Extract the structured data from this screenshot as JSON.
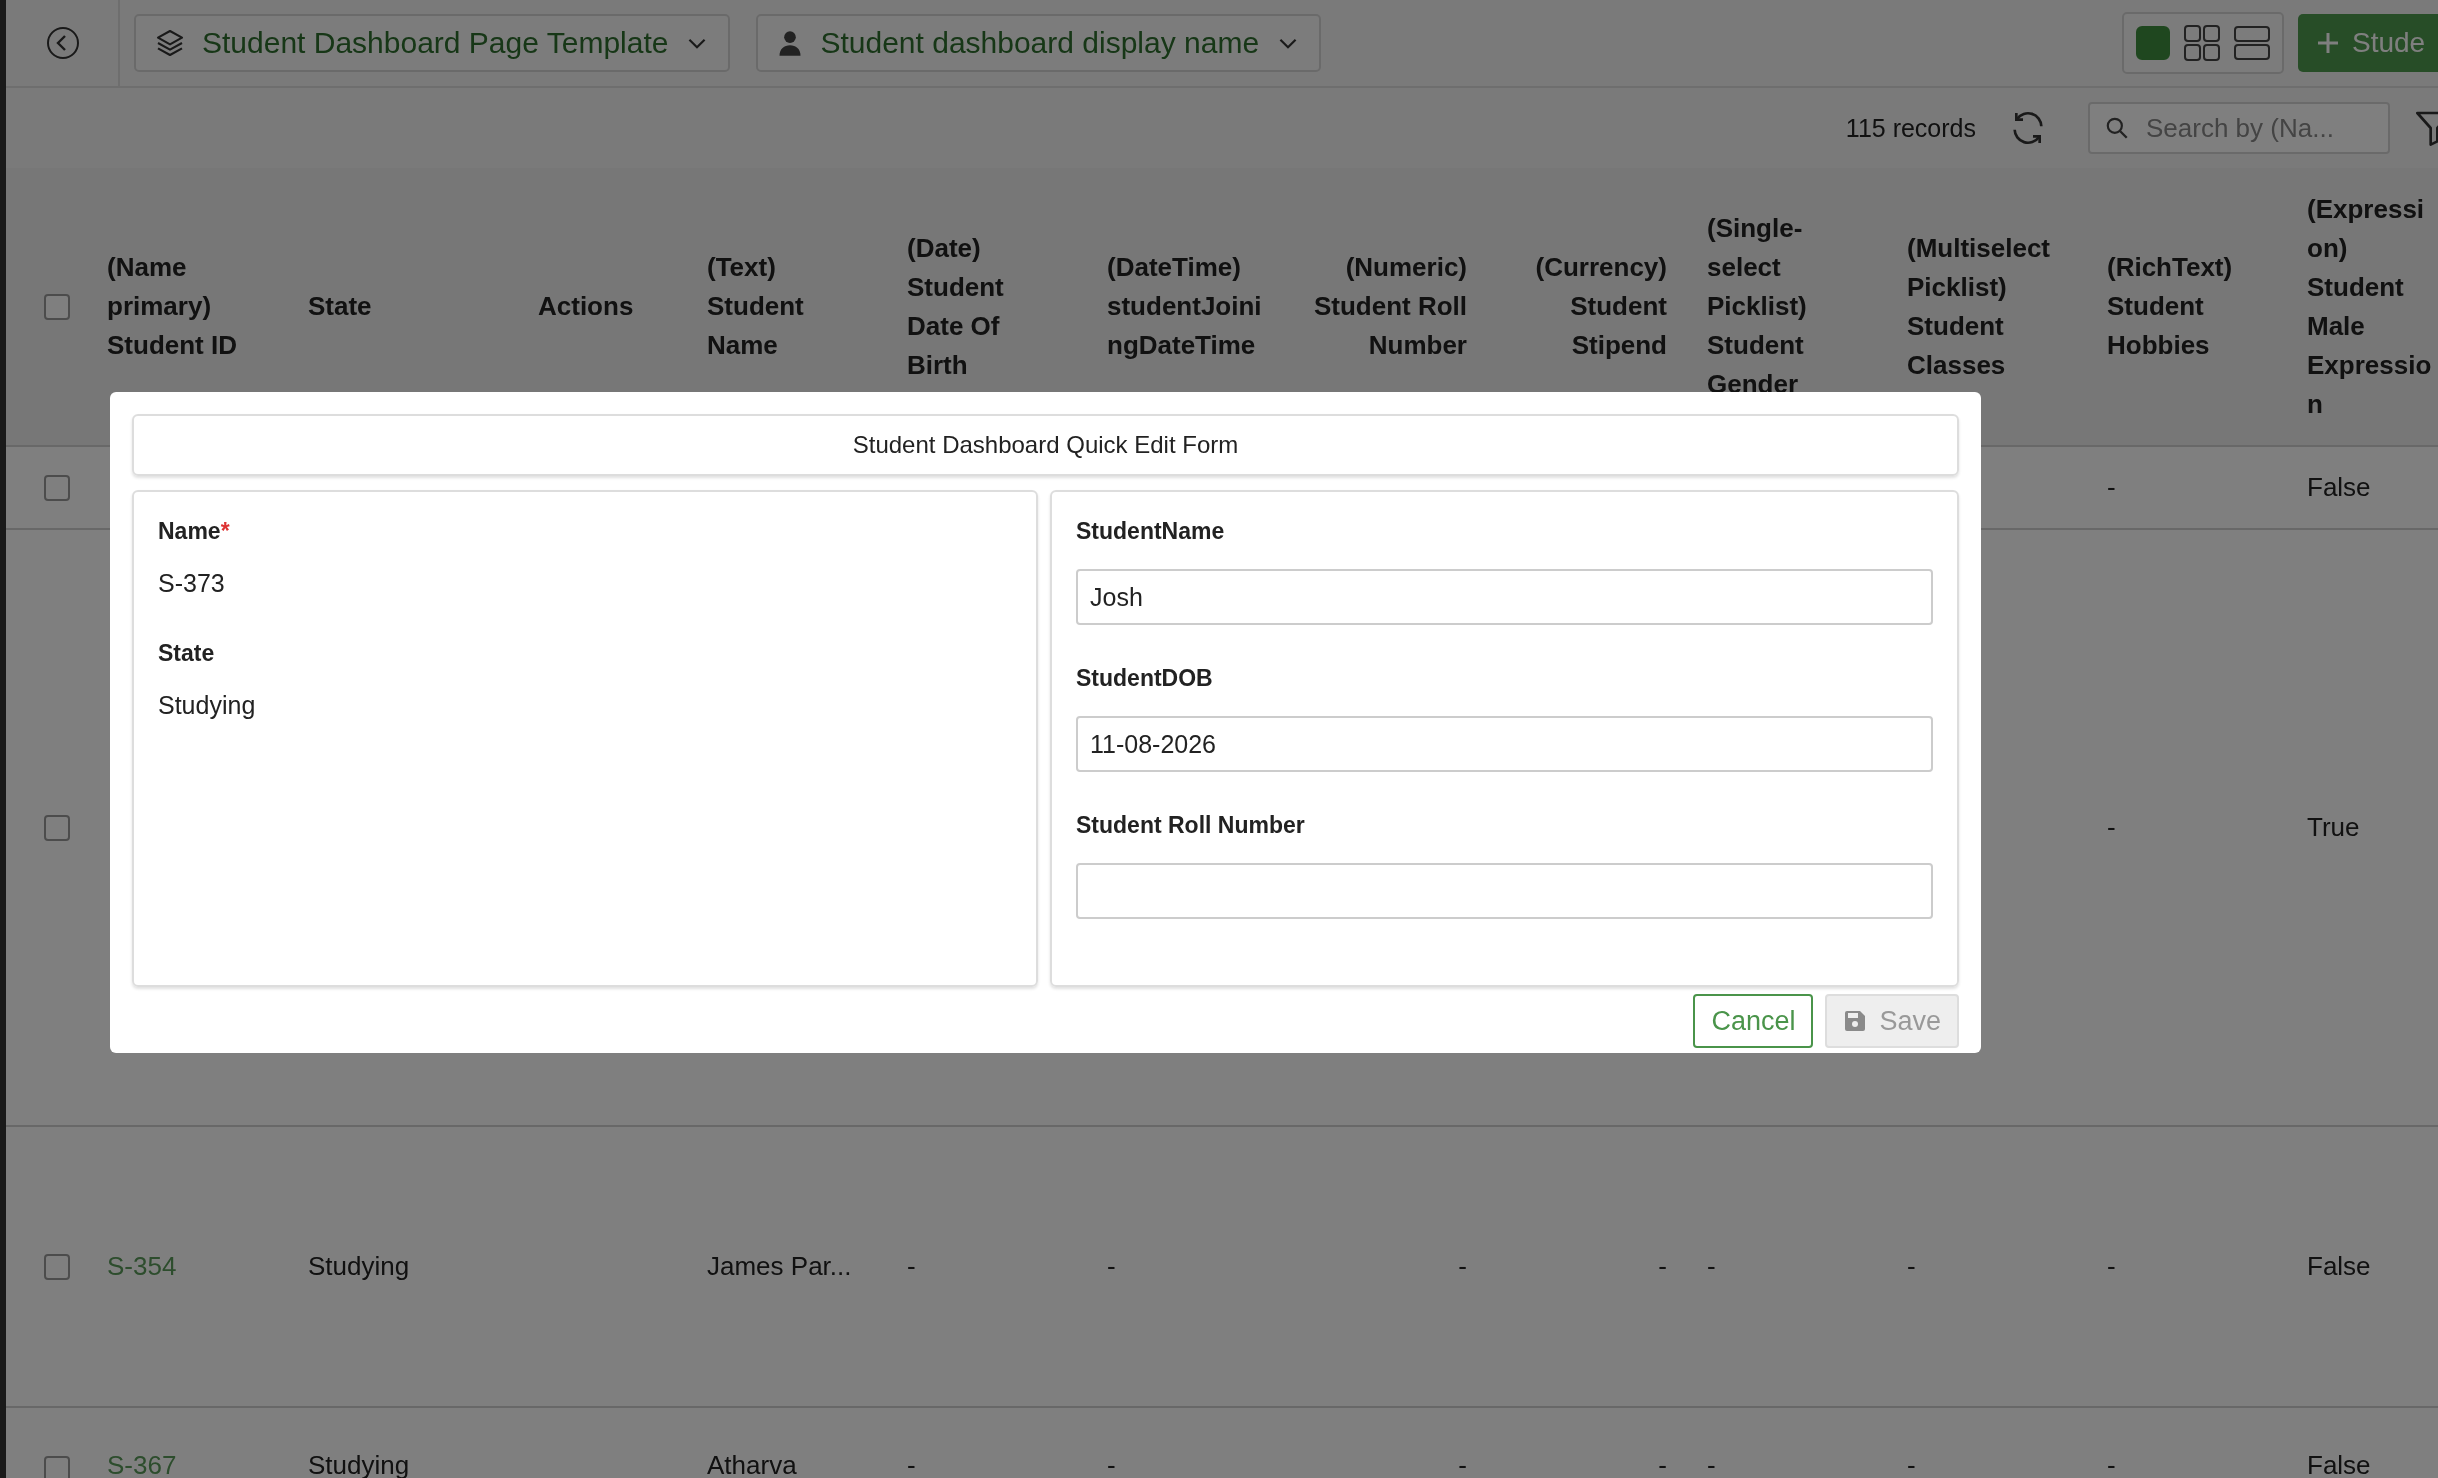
{
  "top_bar": {
    "template_dropdown": {
      "label": "Student Dashboard Page Template"
    },
    "display_name_dropdown": {
      "label": "Student dashboard display name"
    },
    "view_modes": [
      {
        "kind": "single",
        "selected": true
      },
      {
        "kind": "grid",
        "selected": false
      },
      {
        "kind": "list",
        "selected": false
      }
    ],
    "add_button": {
      "label": "Stude"
    }
  },
  "toolbar": {
    "record_count": "115 records",
    "search": {
      "placeholder": "Search by (Na..."
    }
  },
  "table": {
    "select_all_checked": false,
    "columns": [
      "(Name primary) Student ID",
      "State",
      "Actions",
      "(Text) Student Name",
      "(Date) Student Date Of Birth",
      "(DateTime) studentJoiningDateTime",
      "(Numeric) Student Roll Number",
      "(Currency) Student Stipend",
      "(Single-select Picklist) Student Gender",
      "(Multiselect Picklist) Student Classes",
      "(RichText) Student Hobbies",
      "(Expression) Student Male Expression"
    ],
    "rows": [
      {
        "checked": false,
        "hobbies": "-",
        "male_expression": "False"
      },
      {
        "checked": false,
        "hobbies": "-",
        "male_expression": "True"
      },
      {
        "checked": false,
        "student_id": "S-354",
        "state": "Studying",
        "student_name": "James Par...",
        "date_of_birth": "-",
        "joining_datetime": "-",
        "roll_number": "-",
        "stipend": "-",
        "gender": "-",
        "classes": "-",
        "hobbies": "-",
        "male_expression": "False"
      },
      {
        "checked": false,
        "student_id": "S-367",
        "state": "Studying",
        "student_name": "Atharva",
        "date_of_birth": "-",
        "joining_datetime": "-",
        "roll_number": "-",
        "stipend": "-",
        "gender": "-",
        "classes": "-",
        "hobbies": "-",
        "male_expression": "False"
      }
    ]
  },
  "quick_edit_form": {
    "title": "Student Dashboard Quick Edit Form",
    "left_fields": [
      {
        "label": "Name",
        "required_mark": "*",
        "value": "S-373"
      },
      {
        "label": "State",
        "value": "Studying"
      }
    ],
    "right_fields": [
      {
        "label": "StudentName",
        "value": "Josh"
      },
      {
        "label": "StudentDOB",
        "value": "11-08-2026"
      },
      {
        "label": "Student Roll Number"
      }
    ],
    "buttons": [
      {
        "kind": "cancel",
        "label": "Cancel",
        "disabled": false
      },
      {
        "kind": "save",
        "label": "Save",
        "disabled": true
      }
    ]
  }
}
